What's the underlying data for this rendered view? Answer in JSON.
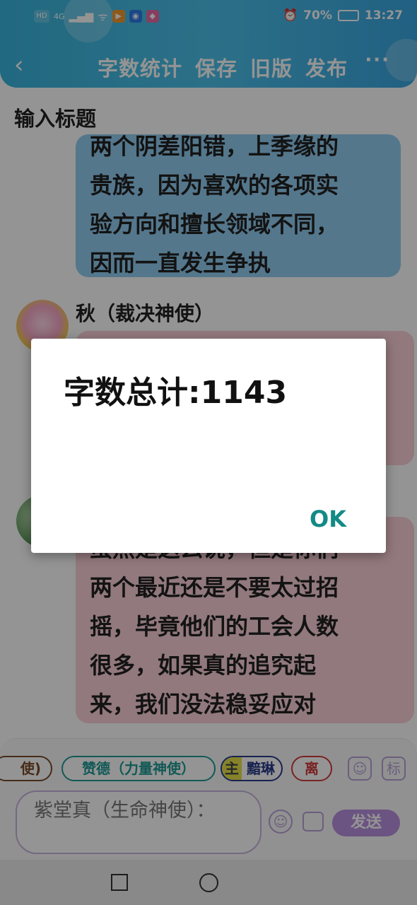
{
  "status_bar": {
    "network": "4G",
    "hd_label": "HD",
    "battery": "70%",
    "time": "13:27"
  },
  "header": {
    "back_icon": "chevron-left-icon",
    "nav": [
      "字数统计",
      "保存",
      "旧版",
      "发布"
    ],
    "more_icon": "more-dots-icon"
  },
  "title_placeholder": "输入标题",
  "messages": [
    {
      "speaker": "",
      "color": "#91cdf2",
      "lines": [
        "两个阴差阳错，上季缘的",
        "贵族，因为喜欢的各项实",
        "验方向和擅长领域不同，",
        "因而一直发生争执"
      ]
    },
    {
      "speaker": "秋（裁决神使）",
      "color": "#fcd0d7",
      "lines": [
        "",
        "",
        ""
      ]
    },
    {
      "speaker": "",
      "color": "#fcd0d7",
      "lines": [
        "虽然是这么说，但是你们",
        "两个最近还是不要太过招",
        "摇，毕竟他们的工会人数",
        "很多，如果真的追究起",
        "来，我们没法稳妥应对"
      ]
    }
  ],
  "chips": [
    {
      "label": "使)",
      "color": "#7a4a2a"
    },
    {
      "label": "赞德（力量神使）",
      "color": "#1f9a94"
    },
    {
      "label": "主",
      "color": "#444444"
    },
    {
      "label": "黯琳",
      "color": "#2a3c8a"
    },
    {
      "label": "离",
      "color": "#d23b3b"
    }
  ],
  "panel_buttons": {
    "person_icon": "person-icon",
    "tag_label": "标"
  },
  "input": {
    "value": "紫堂真（生命神使）："
  },
  "send_label": "发送",
  "dialog": {
    "message": "字数总计:1143",
    "ok_label": "OK"
  }
}
